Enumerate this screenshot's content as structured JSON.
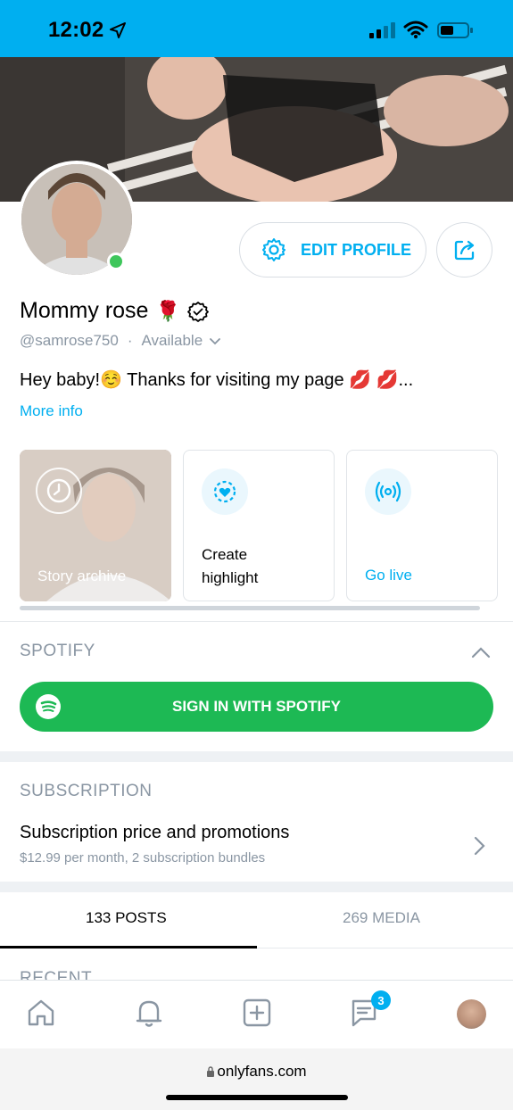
{
  "status_bar": {
    "time": "12:02",
    "icons": [
      "location-arrow-icon",
      "signal-icon",
      "wifi-icon",
      "battery-icon"
    ]
  },
  "profile": {
    "name": "Mommy rose",
    "name_emoji": "🌹",
    "handle": "@samrose750",
    "separator": "·",
    "availability": "Available",
    "bio": "Hey baby!☺️ Thanks for visiting my page 💋 💋...",
    "more_info": "More info",
    "edit_button": "EDIT PROFILE"
  },
  "cards": {
    "story_archive": "Story archive",
    "create_highlight_line1": "Create",
    "create_highlight_line2": "highlight",
    "go_live": "Go live"
  },
  "spotify": {
    "section_title": "SPOTIFY",
    "button_label": "SIGN IN WITH SPOTIFY"
  },
  "subscription": {
    "section_title": "SUBSCRIPTION",
    "row_title": "Subscription price and promotions",
    "row_subtitle": "$12.99 per month, 2 subscription bundles"
  },
  "tabs": {
    "posts": "133 POSTS",
    "media": "269 MEDIA",
    "active": "posts"
  },
  "recent_label": "RECENT",
  "bottom_nav": {
    "items": [
      "home-icon",
      "bell-icon",
      "add-post-icon",
      "messages-icon",
      "profile-avatar"
    ],
    "messages_badge": "3"
  },
  "browser": {
    "url": "onlyfans.com"
  },
  "colors": {
    "accent": "#00AFF0",
    "spotify_green": "#1DB954",
    "online": "#3ec65b",
    "muted_text": "#8a96a3"
  }
}
